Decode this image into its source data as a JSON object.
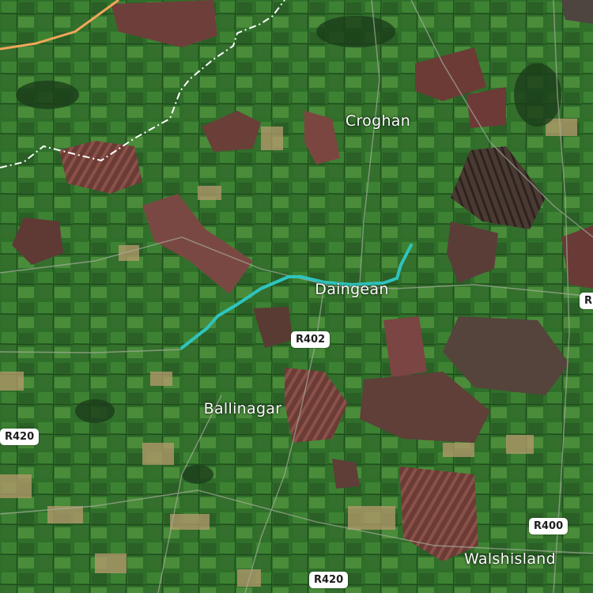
{
  "map": {
    "type": "satellite",
    "place_labels": {
      "croghan": "Croghan",
      "daingean": "Daingean",
      "ballinagar": "Ballinagar",
      "walshisland": "Walshisland"
    },
    "road_shields": {
      "r402": "R402",
      "r420_west": "R420",
      "r420_south": "R420",
      "r400": "R400",
      "r4_east": "R"
    },
    "colors": {
      "route": "#2ec4bf",
      "boundary": "#ffffff",
      "highway": "#f2a65a",
      "bog": "#7a4a42",
      "field": "#3d7d34"
    }
  }
}
